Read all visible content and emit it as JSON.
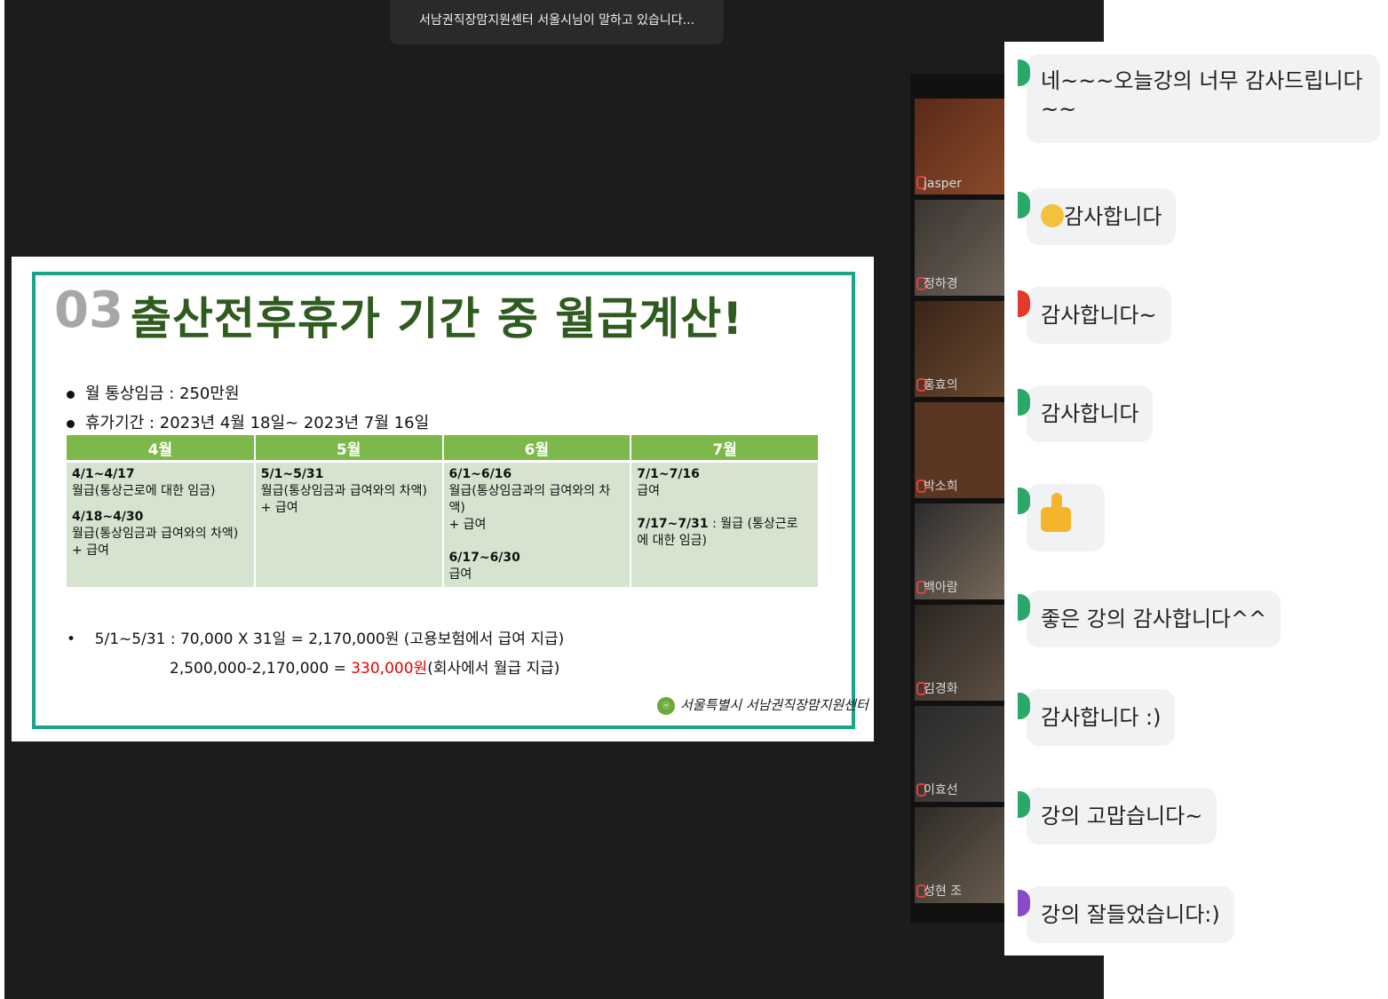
{
  "speaker_banner": "서남권직장맘지원센터 서울시님이 말하고 있습니다...",
  "slide": {
    "number": "03",
    "title": "출산전후휴가 기간 중 월급계산!",
    "bullets": [
      "월 통상임금 : 250만원",
      "휴가기간 : 2023년 4월 18일~ 2023년 7월   16일"
    ],
    "table_headers": [
      "4월",
      "5월",
      "6월",
      "7월"
    ],
    "april": {
      "r1": "4/1~4/17",
      "t1": "월급(통상근로에 대한 임금)",
      "r2": "4/18~4/30",
      "t2": "월급(통상임금과 급여와의 차액)",
      "t3": "+ 급여"
    },
    "may": {
      "r1": "5/1~5/31",
      "t1": "월급(통상임금과 급여와의 차액)",
      "t2": "+ 급여"
    },
    "june": {
      "r1": "6/1~6/16",
      "t1": "월급(통상임금과의 급여와의 차액)",
      "t2": "+ 급여",
      "r2": "6/17~6/30",
      "t3": "급여"
    },
    "july": {
      "r1": "7/1~7/16",
      "t1": "급여",
      "r2": "7/17~7/31",
      "t2": " : 월급 (통상근로",
      "t3": "에 대한 임금)"
    },
    "calc_line1": "5/1~5/31 : 70,000 X 31일  =  2,170,000원 (고용보험에서 급여 지급)",
    "calc_line2_prefix": "2,500,000-2,170,000  =  ",
    "calc_line2_amount": "330,000원",
    "calc_line2_suffix": "(회사에서 월급 지급)",
    "logo_text": "서울특별시 서남권직장맘지원센터"
  },
  "participants": [
    "jasper",
    "정하경",
    "홍효의",
    "박소희",
    "백아람",
    "김경화",
    "이효선",
    "성현 조"
  ],
  "chat_messages": [
    "네~~~오늘강의 너무 감사드립니다",
    "~~",
    "감사합니다",
    "감사합니다~",
    "감사합니다",
    "좋은 강의 감사합니다^^",
    "감사합니다 :)",
    "강의 고맙습니다~",
    "강의 잘들었습니다:)"
  ],
  "colors": {
    "accent_green": "#1aa58a",
    "title_green": "#2f5b1f",
    "header_green": "#7cb84a",
    "cell_green": "#d6e4cf",
    "highlight_red": "#e60000"
  }
}
